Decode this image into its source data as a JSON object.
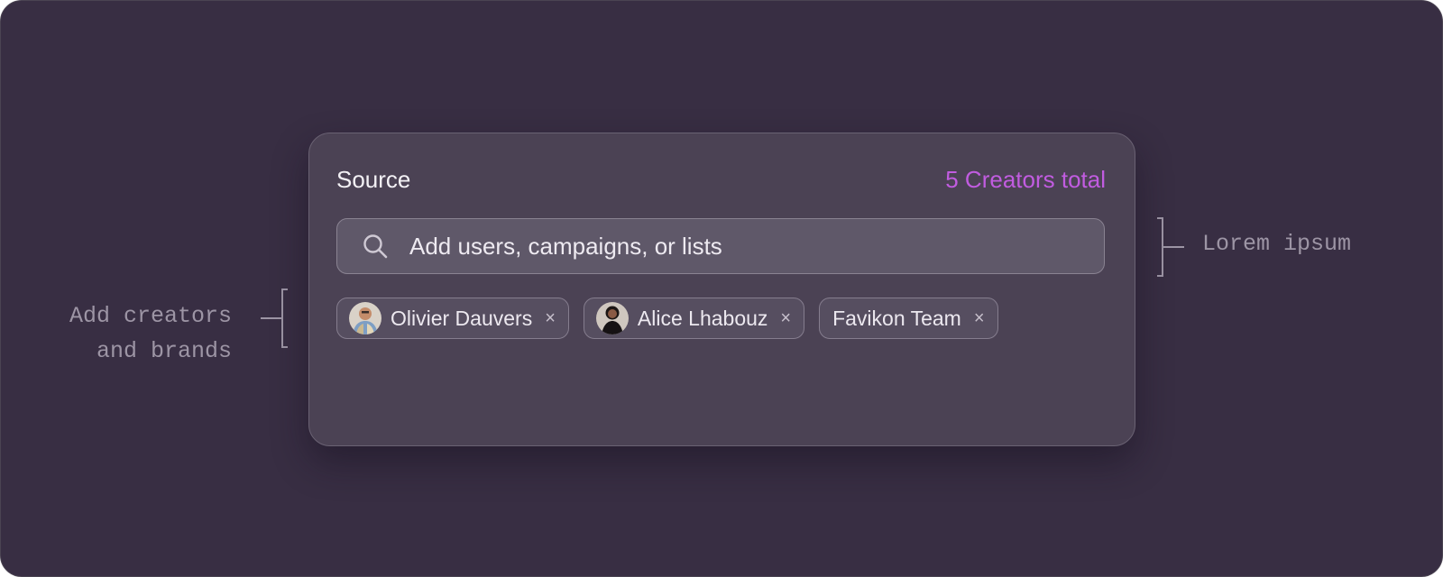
{
  "card": {
    "title": "Source",
    "total": "5 Creators total"
  },
  "search": {
    "placeholder": "Add users, campaigns, or lists",
    "icon": "search-icon"
  },
  "chips": [
    {
      "label": "Olivier Dauvers",
      "has_avatar": true,
      "close": "×"
    },
    {
      "label": "Alice Lhabouz",
      "has_avatar": true,
      "close": "×"
    },
    {
      "label": "Favikon Team",
      "has_avatar": false,
      "close": "×"
    }
  ],
  "annotations": {
    "left_line1": "Add creators",
    "left_line2": "and brands",
    "right": "Lorem ipsum"
  },
  "colors": {
    "background": "#382e43",
    "card": "#4b4254",
    "accent": "#c15ce0",
    "annotation": "#9d95a5"
  }
}
